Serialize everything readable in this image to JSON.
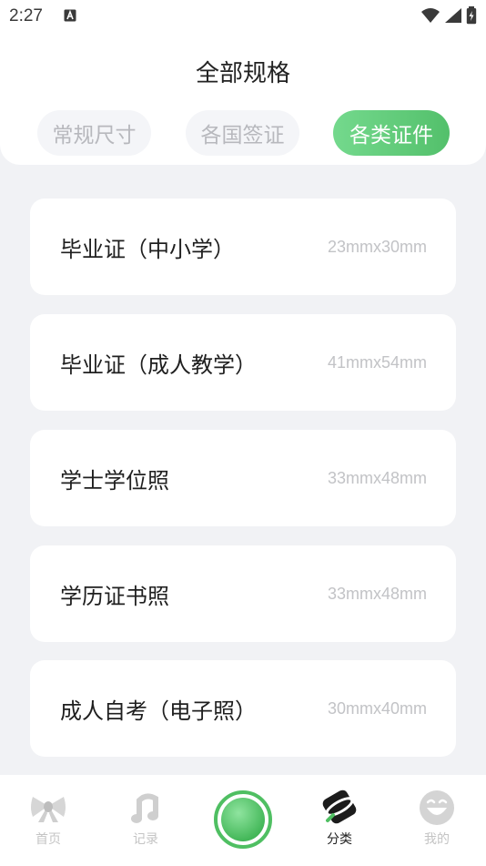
{
  "status_bar": {
    "time": "2:27",
    "notification_icon": "a-box-icon",
    "icons": [
      "wifi-icon",
      "signal-icon",
      "battery-charging-icon"
    ]
  },
  "header": {
    "title": "全部规格"
  },
  "tabs": [
    {
      "label": "常规尺寸",
      "active": false
    },
    {
      "label": "各国签证",
      "active": false
    },
    {
      "label": "各类证件",
      "active": true
    }
  ],
  "spec_list": [
    {
      "name": "毕业证（中小学）",
      "size": "23mmx30mm"
    },
    {
      "name": "毕业证（成人教学）",
      "size": "41mmx54mm"
    },
    {
      "name": "学士学位照",
      "size": "33mmx48mm"
    },
    {
      "name": "学历证书照",
      "size": "33mmx48mm"
    },
    {
      "name": "成人自考（电子照）",
      "size": "30mmx40mm"
    }
  ],
  "bottom_nav": {
    "items": [
      {
        "label": "首页",
        "icon": "bow-icon",
        "active": false
      },
      {
        "label": "记录",
        "icon": "music-note-icon",
        "active": false
      },
      {
        "label": "",
        "icon": "camera-shutter-icon",
        "active": false
      },
      {
        "label": "分类",
        "icon": "category-icon",
        "active": true
      },
      {
        "label": "我的",
        "icon": "smiley-icon",
        "active": false
      }
    ]
  },
  "colors": {
    "accent": "#5bc873",
    "background": "#f1f2f5",
    "inactive_text": "#c4c4c4"
  }
}
